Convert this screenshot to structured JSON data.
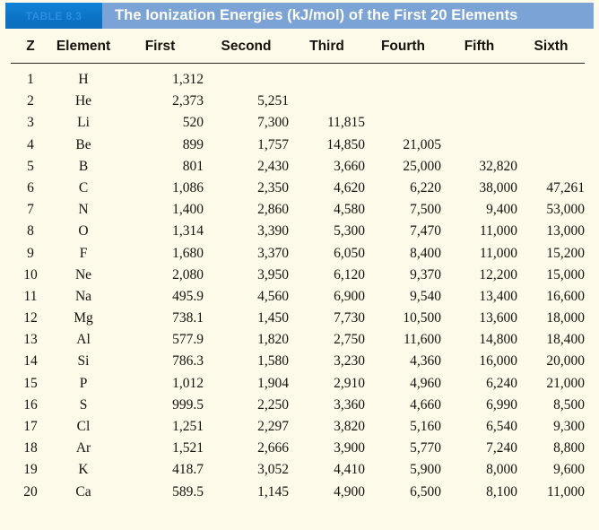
{
  "title": {
    "tag_label": "TABLE 8.3",
    "heading": "The Ionization Energies (kJ/mol) of the First 20 Elements"
  },
  "colors": {
    "title_bar": "#7ba3d6",
    "title_tag": "#0e7fd4",
    "page_background": "#fdfaea",
    "text": "#17120c",
    "rule": "#2b2620"
  },
  "table": {
    "columns": [
      "Z",
      "Element",
      "First",
      "Second",
      "Third",
      "Fourth",
      "Fifth",
      "Sixth"
    ],
    "rows": [
      {
        "z": "1",
        "element": "H",
        "first": "1,312",
        "second": "",
        "third": "",
        "fourth": "",
        "fifth": "",
        "sixth": ""
      },
      {
        "z": "2",
        "element": "He",
        "first": "2,373",
        "second": "5,251",
        "third": "",
        "fourth": "",
        "fifth": "",
        "sixth": ""
      },
      {
        "z": "3",
        "element": "Li",
        "first": "520",
        "second": "7,300",
        "third": "11,815",
        "fourth": "",
        "fifth": "",
        "sixth": ""
      },
      {
        "z": "4",
        "element": "Be",
        "first": "899",
        "second": "1,757",
        "third": "14,850",
        "fourth": "21,005",
        "fifth": "",
        "sixth": ""
      },
      {
        "z": "5",
        "element": "B",
        "first": "801",
        "second": "2,430",
        "third": "3,660",
        "fourth": "25,000",
        "fifth": "32,820",
        "sixth": ""
      },
      {
        "z": "6",
        "element": "C",
        "first": "1,086",
        "second": "2,350",
        "third": "4,620",
        "fourth": "6,220",
        "fifth": "38,000",
        "sixth": "47,261"
      },
      {
        "z": "7",
        "element": "N",
        "first": "1,400",
        "second": "2,860",
        "third": "4,580",
        "fourth": "7,500",
        "fifth": "9,400",
        "sixth": "53,000"
      },
      {
        "z": "8",
        "element": "O",
        "first": "1,314",
        "second": "3,390",
        "third": "5,300",
        "fourth": "7,470",
        "fifth": "11,000",
        "sixth": "13,000"
      },
      {
        "z": "9",
        "element": "F",
        "first": "1,680",
        "second": "3,370",
        "third": "6,050",
        "fourth": "8,400",
        "fifth": "11,000",
        "sixth": "15,200"
      },
      {
        "z": "10",
        "element": "Ne",
        "first": "2,080",
        "second": "3,950",
        "third": "6,120",
        "fourth": "9,370",
        "fifth": "12,200",
        "sixth": "15,000"
      },
      {
        "z": "11",
        "element": "Na",
        "first": "495.9",
        "second": "4,560",
        "third": "6,900",
        "fourth": "9,540",
        "fifth": "13,400",
        "sixth": "16,600"
      },
      {
        "z": "12",
        "element": "Mg",
        "first": "738.1",
        "second": "1,450",
        "third": "7,730",
        "fourth": "10,500",
        "fifth": "13,600",
        "sixth": "18,000"
      },
      {
        "z": "13",
        "element": "Al",
        "first": "577.9",
        "second": "1,820",
        "third": "2,750",
        "fourth": "11,600",
        "fifth": "14,800",
        "sixth": "18,400"
      },
      {
        "z": "14",
        "element": "Si",
        "first": "786.3",
        "second": "1,580",
        "third": "3,230",
        "fourth": "4,360",
        "fifth": "16,000",
        "sixth": "20,000"
      },
      {
        "z": "15",
        "element": "P",
        "first": "1,012",
        "second": "1,904",
        "third": "2,910",
        "fourth": "4,960",
        "fifth": "6,240",
        "sixth": "21,000"
      },
      {
        "z": "16",
        "element": "S",
        "first": "999.5",
        "second": "2,250",
        "third": "3,360",
        "fourth": "4,660",
        "fifth": "6,990",
        "sixth": "8,500"
      },
      {
        "z": "17",
        "element": "Cl",
        "first": "1,251",
        "second": "2,297",
        "third": "3,820",
        "fourth": "5,160",
        "fifth": "6,540",
        "sixth": "9,300"
      },
      {
        "z": "18",
        "element": "Ar",
        "first": "1,521",
        "second": "2,666",
        "third": "3,900",
        "fourth": "5,770",
        "fifth": "7,240",
        "sixth": "8,800"
      },
      {
        "z": "19",
        "element": "K",
        "first": "418.7",
        "second": "3,052",
        "third": "4,410",
        "fourth": "5,900",
        "fifth": "8,000",
        "sixth": "9,600"
      },
      {
        "z": "20",
        "element": "Ca",
        "first": "589.5",
        "second": "1,145",
        "third": "4,900",
        "fourth": "6,500",
        "fifth": "8,100",
        "sixth": "11,000"
      }
    ]
  }
}
